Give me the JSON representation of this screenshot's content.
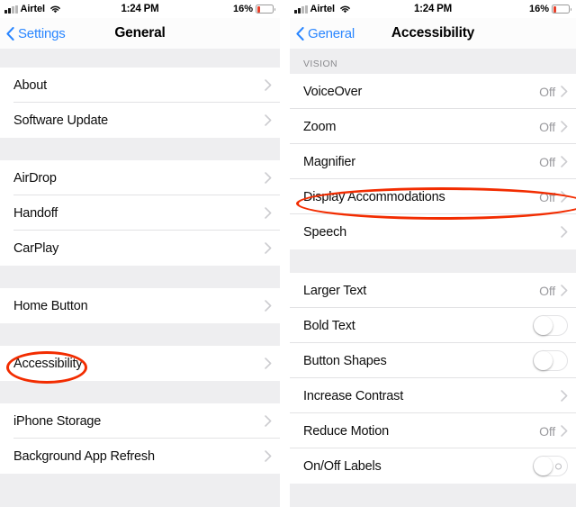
{
  "colors": {
    "accent_blue": "#2a86ff",
    "annotation_red": "#f22c00",
    "battery_red": "#e8402a",
    "value_gray": "#9a9a9e",
    "group_bg": "#eeeef0"
  },
  "left_screen": {
    "status_bar": {
      "carrier": "Airtel",
      "time": "1:24 PM",
      "battery_percent": "16%",
      "signal_bars_filled": 2,
      "signal_bars_total": 4,
      "wifi_icon": "wifi-icon",
      "battery_icon": "battery-low-icon"
    },
    "nav": {
      "back_label": "Settings",
      "back_icon": "chevron-left-icon",
      "title": "General"
    },
    "sections": [
      {
        "rows": [
          {
            "label": "About",
            "value": "",
            "accessory": "chevron"
          },
          {
            "label": "Software Update",
            "value": "",
            "accessory": "chevron"
          }
        ]
      },
      {
        "rows": [
          {
            "label": "AirDrop",
            "value": "",
            "accessory": "chevron"
          },
          {
            "label": "Handoff",
            "value": "",
            "accessory": "chevron"
          },
          {
            "label": "CarPlay",
            "value": "",
            "accessory": "chevron"
          }
        ]
      },
      {
        "rows": [
          {
            "label": "Home Button",
            "value": "",
            "accessory": "chevron"
          }
        ]
      },
      {
        "rows": [
          {
            "label": "Accessibility",
            "value": "",
            "accessory": "chevron",
            "annotated": true
          }
        ]
      },
      {
        "rows": [
          {
            "label": "iPhone Storage",
            "value": "",
            "accessory": "chevron"
          },
          {
            "label": "Background App Refresh",
            "value": "",
            "accessory": "chevron"
          }
        ]
      }
    ]
  },
  "right_screen": {
    "status_bar": {
      "carrier": "Airtel",
      "time": "1:24 PM",
      "battery_percent": "16%",
      "signal_bars_filled": 2,
      "signal_bars_total": 4,
      "wifi_icon": "wifi-icon",
      "battery_icon": "battery-low-icon"
    },
    "nav": {
      "back_label": "General",
      "back_icon": "chevron-left-icon",
      "title": "Accessibility"
    },
    "sections": [
      {
        "header": "VISION",
        "rows": [
          {
            "label": "VoiceOver",
            "value": "Off",
            "accessory": "chevron"
          },
          {
            "label": "Zoom",
            "value": "Off",
            "accessory": "chevron"
          },
          {
            "label": "Magnifier",
            "value": "Off",
            "accessory": "chevron"
          },
          {
            "label": "Display Accommodations",
            "value": "Off",
            "accessory": "chevron",
            "annotated": true
          },
          {
            "label": "Speech",
            "value": "",
            "accessory": "chevron"
          }
        ]
      },
      {
        "header": "",
        "rows": [
          {
            "label": "Larger Text",
            "value": "Off",
            "accessory": "chevron"
          },
          {
            "label": "Bold Text",
            "value": "",
            "accessory": "toggle",
            "toggle_on": false
          },
          {
            "label": "Button Shapes",
            "value": "",
            "accessory": "toggle",
            "toggle_on": false
          },
          {
            "label": "Increase Contrast",
            "value": "",
            "accessory": "chevron"
          },
          {
            "label": "Reduce Motion",
            "value": "Off",
            "accessory": "chevron"
          },
          {
            "label": "On/Off Labels",
            "value": "",
            "accessory": "toggle-labeled",
            "toggle_on": false
          }
        ]
      }
    ]
  }
}
